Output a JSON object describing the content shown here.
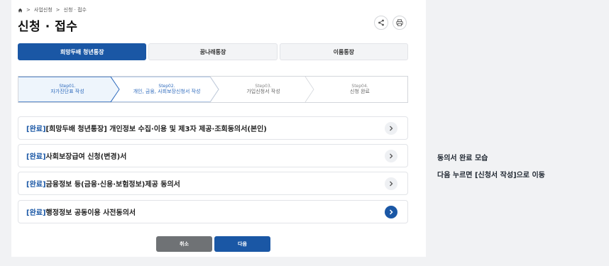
{
  "breadcrumb": [
    "사업신청",
    "신청 · 접수"
  ],
  "page_title": "신청 · 접수",
  "tabs": [
    {
      "label": "희망두배 청년통장",
      "active": true
    },
    {
      "label": "꿈나래통장",
      "active": false
    },
    {
      "label": "이룸통장",
      "active": false
    }
  ],
  "steps": [
    {
      "num": "Step01.",
      "label": "자가진단표 작성",
      "active": true
    },
    {
      "num": "Step02.",
      "label": "개인, 금융, 사회보장신청서 작성",
      "active": true
    },
    {
      "num": "Step03.",
      "label": "가입신청서 작성",
      "active": false
    },
    {
      "num": "Step04.",
      "label": "신청 완료",
      "active": false
    }
  ],
  "consents": [
    {
      "status": "[완료]",
      "label": "[희망두배 청년통장] 개인정보 수집·이용 및 제3자 제공·조회동의서(본인)"
    },
    {
      "status": "[완료]",
      "label": "사회보장급여 신청(변경)서"
    },
    {
      "status": "[완료]",
      "label": "금융정보 등(금융·신용·보험정보)제공 동의서"
    },
    {
      "status": "[완료]",
      "label": "행정정보 공동이용 사전동의서"
    }
  ],
  "buttons": {
    "cancel": "취소",
    "next": "다음"
  },
  "annotation": {
    "line1": "동의서 완료 모습",
    "line2": "다음 누르면 [신청서 작성]으로 이동"
  },
  "colors": {
    "primary": "#1a57a5",
    "step_active_bg": "#eef5fc",
    "cancel_bg": "#6f7275"
  },
  "icons": [
    "home-icon",
    "share-icon",
    "print-icon",
    "chevron-right-icon"
  ]
}
